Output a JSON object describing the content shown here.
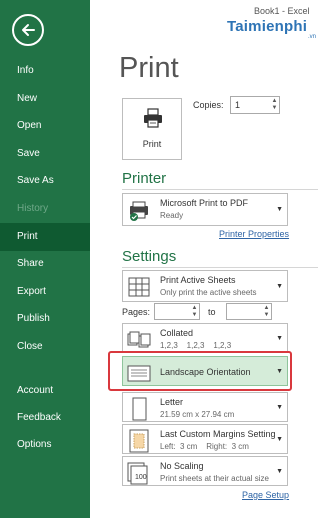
{
  "window": {
    "title": "Book1 - Excel"
  },
  "watermark": {
    "brand": "Taimienphi",
    "suffix": ".vn"
  },
  "nav": {
    "items": [
      {
        "label": "Info"
      },
      {
        "label": "New"
      },
      {
        "label": "Open"
      },
      {
        "label": "Save"
      },
      {
        "label": "Save As"
      },
      {
        "label": "History"
      },
      {
        "label": "Print"
      },
      {
        "label": "Share"
      },
      {
        "label": "Export"
      },
      {
        "label": "Publish"
      },
      {
        "label": "Close"
      },
      {
        "label": "Account"
      },
      {
        "label": "Feedback"
      },
      {
        "label": "Options"
      }
    ],
    "selected": "Print",
    "disabled": "History"
  },
  "main": {
    "title": "Print",
    "print_button_label": "Print",
    "copies_label": "Copies:",
    "copies_value": "1",
    "printer": {
      "section_title": "Printer",
      "name": "Microsoft Print to PDF",
      "status": "Ready",
      "properties_link": "Printer Properties"
    },
    "settings": {
      "section_title": "Settings",
      "what": {
        "title": "Print Active Sheets",
        "subtitle": "Only print the active sheets"
      },
      "pages_label": "Pages:",
      "to_label": "to",
      "collation": {
        "title": "Collated",
        "subtitle": "1,2,3    1,2,3    1,2,3"
      },
      "orientation": {
        "title": "Landscape Orientation"
      },
      "paper": {
        "title": "Letter",
        "subtitle": "21.59 cm x 27.94 cm"
      },
      "margins": {
        "title": "Last Custom Margins Setting",
        "subtitle": "Left:  3 cm    Right:  3 cm"
      },
      "scaling": {
        "title": "No Scaling",
        "subtitle": "Print sheets at their actual size"
      },
      "page_setup_link": "Page Setup"
    }
  },
  "colors": {
    "accent": "#217346",
    "highlight": "#d5ecd9",
    "callout": "#d9383d",
    "link": "#2e64a5"
  }
}
